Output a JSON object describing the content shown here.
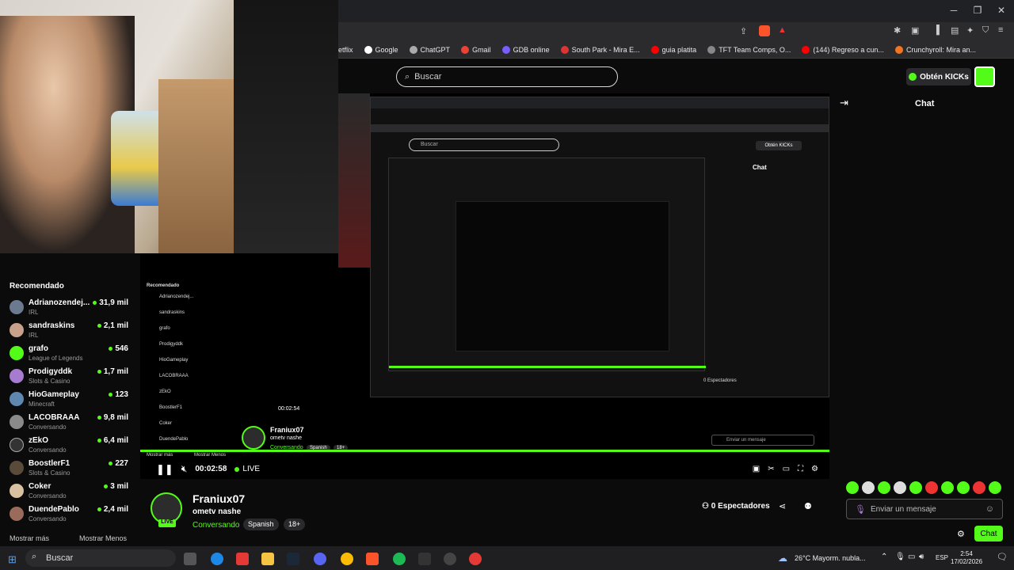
{
  "browser": {
    "bookmarks": [
      "etflix",
      "Google",
      "ChatGPT",
      "Gmail",
      "GDB online",
      "South Park - Mira E...",
      "guia platita",
      "TFT Team Comps, O...",
      "(144) Regreso a cun...",
      "Crunchyroll: Mira an..."
    ]
  },
  "header": {
    "search_placeholder": "Buscar",
    "kicks_label": "Obtén KICKs"
  },
  "sidebar": {
    "title": "Recomendado",
    "items": [
      {
        "name": "Adrianozendej...",
        "category": "IRL",
        "viewers": "31,9 mil"
      },
      {
        "name": "sandraskins",
        "category": "IRL",
        "viewers": "2,1 mil"
      },
      {
        "name": "grafo",
        "category": "League of Legends",
        "viewers": "546"
      },
      {
        "name": "Prodigyddk",
        "category": "Slots & Casino",
        "viewers": "1,7 mil"
      },
      {
        "name": "HioGameplay",
        "category": "Minecraft",
        "viewers": "123"
      },
      {
        "name": "LACOBRAAA",
        "category": "Conversando",
        "viewers": "9,8 mil"
      },
      {
        "name": "zEkO",
        "category": "Conversando",
        "viewers": "6,4 mil"
      },
      {
        "name": "BoostlerF1",
        "category": "Slots & Casino",
        "viewers": "227"
      },
      {
        "name": "Coker",
        "category": "Conversando",
        "viewers": "3 mil"
      },
      {
        "name": "DuendePablo",
        "category": "Conversando",
        "viewers": "2,4 mil"
      }
    ],
    "show_more": "Mostrar más",
    "show_less": "Mostrar Menos"
  },
  "player": {
    "time": "00:02:58",
    "live_label": "LIVE",
    "progress": 1.0,
    "nested_search": "Buscar",
    "nested_kicks": "Obtén KICKs",
    "nested_chat": "Chat",
    "nested_streamer": "Franiux07",
    "nested_title": "ometv nashe",
    "nested_cat": "Conversando",
    "nested_tag1": "Spanish",
    "nested_tag2": "18+",
    "nested_time": "00:02:54",
    "nested_viewers": "0 Espectadores",
    "nested_chat_input": "Enviar un mensaje",
    "nested_rec": "Recomendado",
    "nested_items": [
      "Adrianozendej...",
      "sandraskins",
      "grafo",
      "Prodigyddk",
      "HioGameplay",
      "LACOBRAAA",
      "zEkO",
      "BoostlerF1",
      "Coker",
      "DuendePablo"
    ],
    "nested_show_more": "Mostrar más",
    "nested_show_less": "Mostrar Menos"
  },
  "stream": {
    "streamer": "Franiux07",
    "title": "ometv nashe",
    "category": "Conversando",
    "tags": [
      "Spanish",
      "18+"
    ],
    "live_badge": "LIVE",
    "viewers": "0 Espectadores"
  },
  "chat": {
    "title": "Chat",
    "input_placeholder": "Enviar un mensaje",
    "send_label": "Chat"
  },
  "taskbar": {
    "search_label": "Buscar",
    "weather": "26°C  Mayorm. nubla...",
    "lang": "ESP",
    "time": "2:54",
    "date": "17/02/2026"
  },
  "colors": {
    "accent": "#53fc18"
  }
}
